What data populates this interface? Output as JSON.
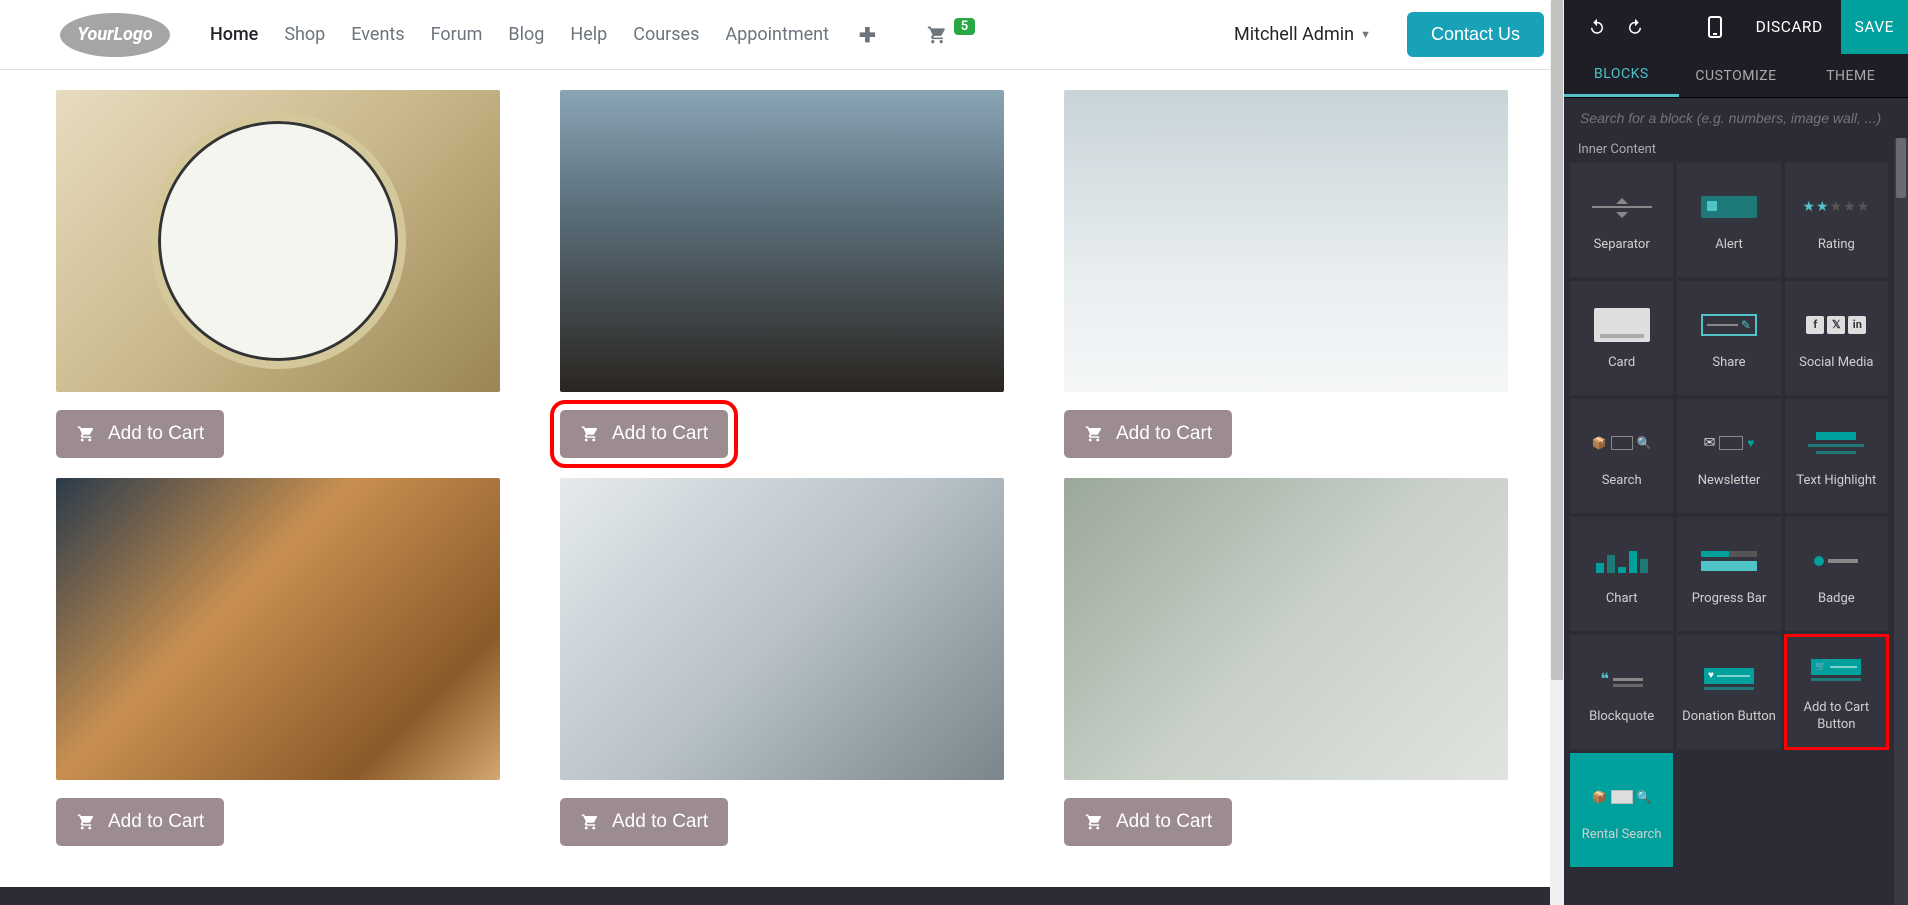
{
  "header": {
    "logo_text": "YourLogo",
    "nav": [
      "Home",
      "Shop",
      "Events",
      "Forum",
      "Blog",
      "Help",
      "Courses",
      "Appointment"
    ],
    "active_nav_index": 0,
    "cart_count": "5",
    "user_name": "Mitchell Admin",
    "contact_label": "Contact Us"
  },
  "products": {
    "add_to_cart_label": "Add to Cart"
  },
  "editor": {
    "top": {
      "discard_label": "DISCARD",
      "save_label": "SAVE"
    },
    "tabs": [
      "BLOCKS",
      "CUSTOMIZE",
      "THEME"
    ],
    "active_tab_index": 0,
    "search_placeholder": "Search for a block (e.g. numbers, image wall, ...)",
    "section_label": "Inner Content",
    "blocks": [
      {
        "label": "Separator"
      },
      {
        "label": "Alert"
      },
      {
        "label": "Rating"
      },
      {
        "label": "Card"
      },
      {
        "label": "Share"
      },
      {
        "label": "Social Media"
      },
      {
        "label": "Search"
      },
      {
        "label": "Newsletter"
      },
      {
        "label": "Text Highlight"
      },
      {
        "label": "Chart"
      },
      {
        "label": "Progress Bar"
      },
      {
        "label": "Badge"
      },
      {
        "label": "Blockquote"
      },
      {
        "label": "Donation Button"
      },
      {
        "label": "Add to Cart Button"
      },
      {
        "label": "Rental Search"
      }
    ]
  },
  "colors": {
    "accent_teal": "#00a09d",
    "header_teal": "#17a2b8",
    "btn_mauve": "#9c8b8f",
    "highlight_red": "#ff0000"
  }
}
